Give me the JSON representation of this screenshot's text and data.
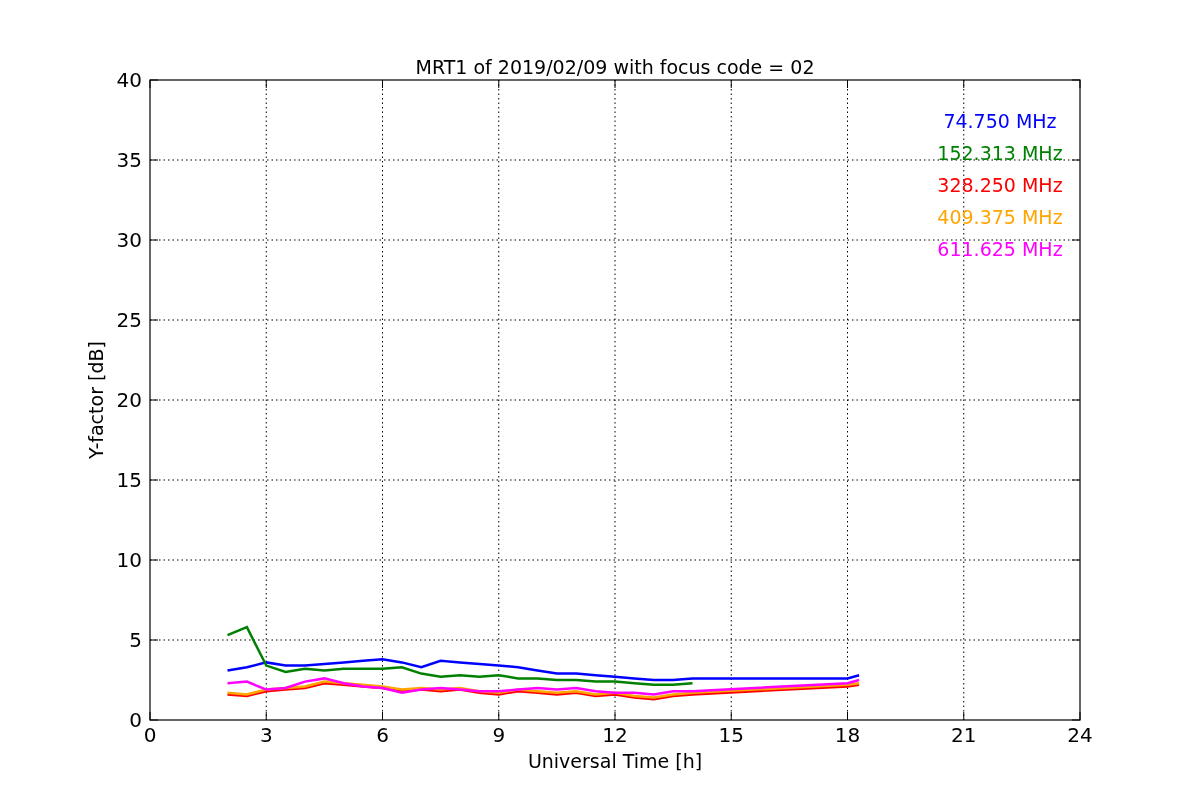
{
  "chart_data": {
    "type": "line",
    "title": "MRT1 of 2019/02/09 with focus code = 02",
    "xlabel": "Universal Time [h]",
    "ylabel": "Y-factor [dB]",
    "x": [
      2,
      2.5,
      3,
      3.5,
      4,
      4.5,
      5,
      5.5,
      6,
      6.5,
      7,
      7.5,
      8,
      8.5,
      9,
      9.5,
      10,
      10.5,
      11,
      11.5,
      12,
      12.5,
      13,
      13.5,
      14,
      18,
      18.3
    ],
    "series": [
      {
        "name": "74.750 MHz",
        "color": "#0000ff",
        "values": [
          3.1,
          3.3,
          3.6,
          3.4,
          3.4,
          3.5,
          3.6,
          3.7,
          3.8,
          3.6,
          3.3,
          3.7,
          3.6,
          3.5,
          3.4,
          3.3,
          3.1,
          2.9,
          2.9,
          2.8,
          2.7,
          2.6,
          2.5,
          2.5,
          2.6,
          2.6,
          2.8
        ]
      },
      {
        "name": "152.313 MHz",
        "color": "#008000",
        "values": [
          5.3,
          5.8,
          3.4,
          3.0,
          3.2,
          3.1,
          3.2,
          3.2,
          3.2,
          3.3,
          2.9,
          2.7,
          2.8,
          2.7,
          2.8,
          2.6,
          2.6,
          2.5,
          2.5,
          2.4,
          2.4,
          2.3,
          2.2,
          2.2,
          2.3,
          null,
          null
        ]
      },
      {
        "name": "328.250 MHz",
        "color": "#ff0000",
        "values": [
          1.6,
          1.5,
          1.8,
          1.9,
          2.0,
          2.3,
          2.2,
          2.1,
          2.0,
          1.8,
          1.9,
          1.8,
          1.9,
          1.7,
          1.6,
          1.8,
          1.7,
          1.6,
          1.7,
          1.5,
          1.6,
          1.4,
          1.3,
          1.5,
          1.6,
          2.1,
          2.2
        ]
      },
      {
        "name": "409.375 MHz",
        "color": "#ffa500",
        "values": [
          1.7,
          1.6,
          1.9,
          2.0,
          2.1,
          2.4,
          2.3,
          2.2,
          2.1,
          1.9,
          2.0,
          1.9,
          2.0,
          1.8,
          1.7,
          1.9,
          1.8,
          1.7,
          1.8,
          1.6,
          1.7,
          1.5,
          1.4,
          1.6,
          1.7,
          2.2,
          2.3
        ]
      },
      {
        "name": "611.625 MHz",
        "color": "#ff00ff",
        "values": [
          2.3,
          2.4,
          1.9,
          2.0,
          2.4,
          2.6,
          2.3,
          2.1,
          2.0,
          1.7,
          1.9,
          2.0,
          1.9,
          1.8,
          1.8,
          1.9,
          2.0,
          1.9,
          2.0,
          1.8,
          1.7,
          1.7,
          1.6,
          1.8,
          1.8,
          2.3,
          2.5
        ]
      }
    ],
    "grid": true,
    "xlim": [
      0,
      24
    ],
    "ylim": [
      0,
      40
    ],
    "xticks": [
      0,
      3,
      6,
      9,
      12,
      15,
      18,
      21,
      24
    ],
    "yticks": [
      0,
      5,
      10,
      15,
      20,
      25,
      30,
      35,
      40
    ]
  }
}
